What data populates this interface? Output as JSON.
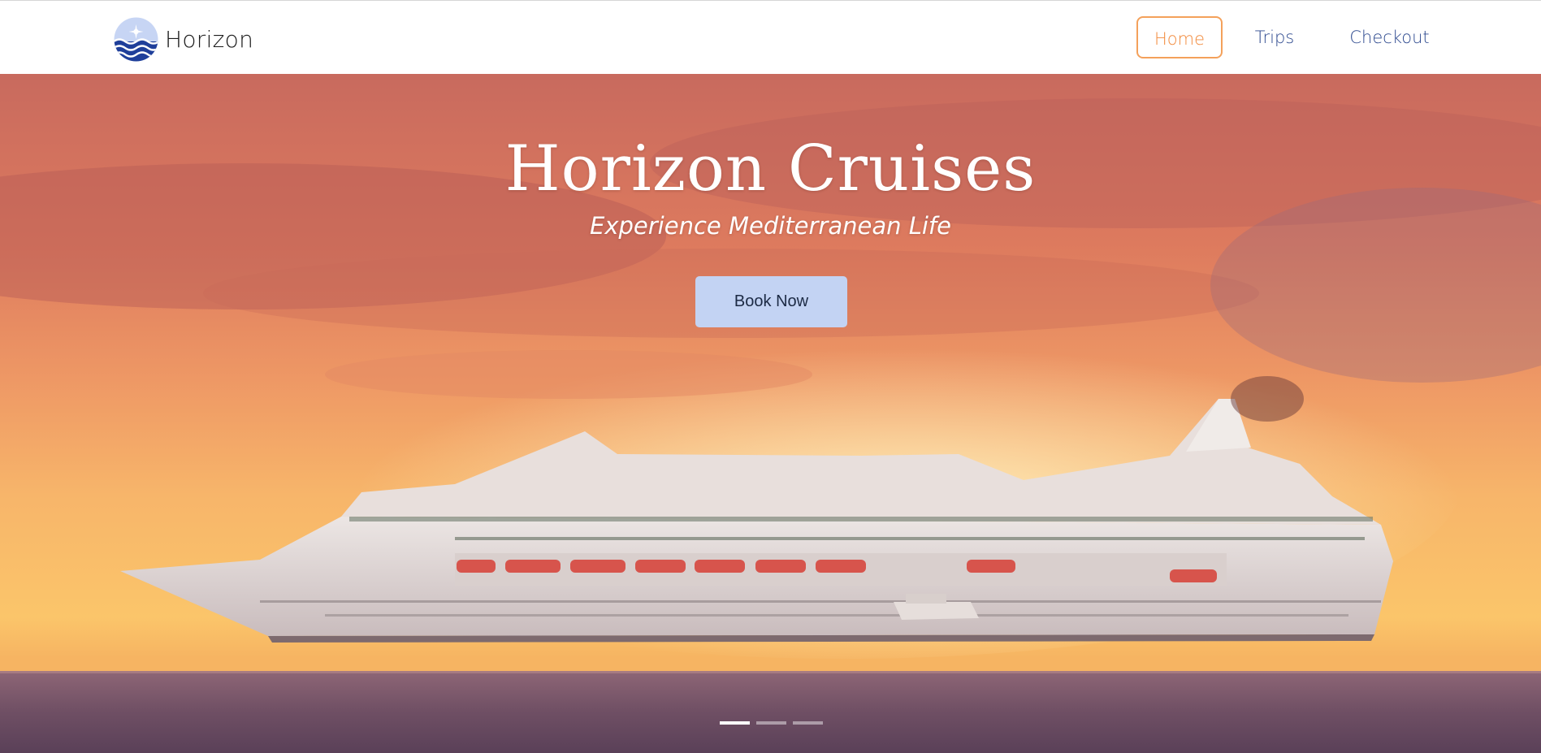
{
  "brand": {
    "name": "Horizon",
    "logo_icon": "sun-over-waves-logo-icon"
  },
  "nav": {
    "items": [
      {
        "label": "Home",
        "active": true
      },
      {
        "label": "Trips",
        "active": false
      },
      {
        "label": "Checkout",
        "active": false
      }
    ]
  },
  "hero": {
    "title": "Horizon Cruises",
    "subtitle": "Experience Mediterranean Life",
    "cta_label": "Book Now",
    "background": "cruise-ship-at-sunset-image",
    "carousel": {
      "slides": 3,
      "active_index": 0
    }
  },
  "colors": {
    "accent": "#f28a3c",
    "nav_text": "#2e4a8f",
    "button_bg": "#c3d3f3",
    "logo_blue": "#1f3f9a"
  }
}
